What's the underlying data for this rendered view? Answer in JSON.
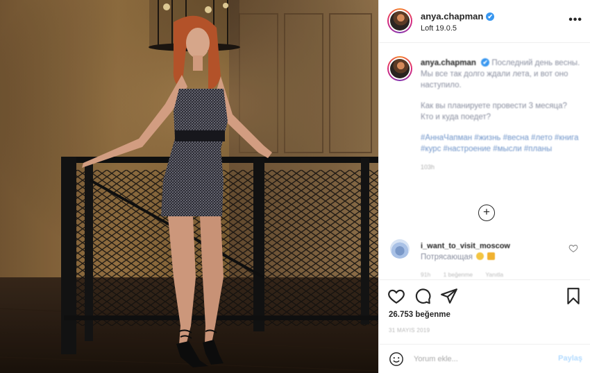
{
  "header": {
    "username": "anya.chapman",
    "verified_badge": "✔",
    "location": "Loft 19.0.5",
    "more_label": "•••"
  },
  "caption": {
    "username": "anya.chapman",
    "paragraph1": "Последний день весны. Мы все так долго ждали лета, и вот оно наступило.",
    "paragraph2": "Как вы планируете провести 3 месяца? Кто и куда поедет?",
    "hashtags": "#АннаЧапман #жизнь #весна #лето #книга #курс #настроение #мысли #планы",
    "time": "103h"
  },
  "load_more_label": "+",
  "comment": {
    "username": "i_want_to_visit_moscow",
    "text": "Потрясающая",
    "meta_time": "91h",
    "meta_likes": "1 beğenme",
    "meta_reply": "Yanıtla"
  },
  "likes_count": "26.753 beğenme",
  "post_date": "31 MAYIS 2019",
  "comment_input": {
    "placeholder": "Yorum ekle...",
    "post_label": "Paylaş"
  },
  "icons": {
    "heart": "heart-icon",
    "comment": "comment-icon",
    "share": "share-icon",
    "save": "bookmark-icon",
    "emoji": "smiley-icon"
  },
  "colors": {
    "verified": "#3897f0",
    "hashtag": "#6f94c9",
    "post_button": "#b3dbff"
  }
}
